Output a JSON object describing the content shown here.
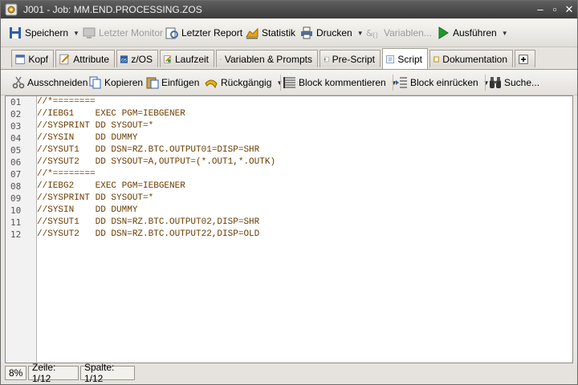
{
  "window": {
    "title": "J001 - Job: MM.END.PROCESSING.ZOS"
  },
  "toolbar": {
    "save": "Speichern",
    "last_monitor": "Letzter Monitor",
    "last_report": "Letzter Report",
    "statistics": "Statistik",
    "print": "Drucken",
    "variables": "Variablen...",
    "execute": "Ausführen"
  },
  "tabs": [
    {
      "label": "Kopf"
    },
    {
      "label": "Attribute"
    },
    {
      "label": "z/OS"
    },
    {
      "label": "Laufzeit"
    },
    {
      "label": "Variablen & Prompts"
    },
    {
      "label": "Pre-Script"
    },
    {
      "label": "Script"
    },
    {
      "label": "Dokumentation"
    }
  ],
  "active_tab": "Script",
  "edit_toolbar": {
    "cut": "Ausschneiden",
    "copy": "Kopieren",
    "paste": "Einfügen",
    "undo": "Rückgängig",
    "comment_block": "Block kommentieren",
    "indent_block": "Block einrücken",
    "search": "Suche..."
  },
  "script": {
    "line_numbers": [
      "01",
      "02",
      "03",
      "04",
      "05",
      "06",
      "07",
      "08",
      "09",
      "10",
      "11",
      "12"
    ],
    "lines": [
      "//*========",
      "//IEBG1    EXEC PGM=IEBGENER",
      "//SYSPRINT DD SYSOUT=*",
      "//SYSIN    DD DUMMY",
      "//SYSUT1   DD DSN=RZ.BTC.OUTPUT01=DISP=SHR",
      "//SYSUT2   DD SYSOUT=A,OUTPUT=(*.OUT1,*.OUTK)",
      "//*========",
      "//IEBG2    EXEC PGM=IEBGENER",
      "//SYSPRINT DD SYSOUT=*",
      "//SYSIN    DD DUMMY",
      "//SYSUT1   DD DSN=RZ.BTC.OUTPUT02,DISP=SHR",
      "//SYSUT2   DD DSN=RZ.BTC.OUTPUT22,DISP=OLD"
    ]
  },
  "status": {
    "zoom": "8%",
    "line": "Zeile: 1/12",
    "column": "Spalte: 1/12"
  },
  "colors": {
    "code_text": "#6b3c00",
    "titlebar": "#4a4a4a"
  }
}
